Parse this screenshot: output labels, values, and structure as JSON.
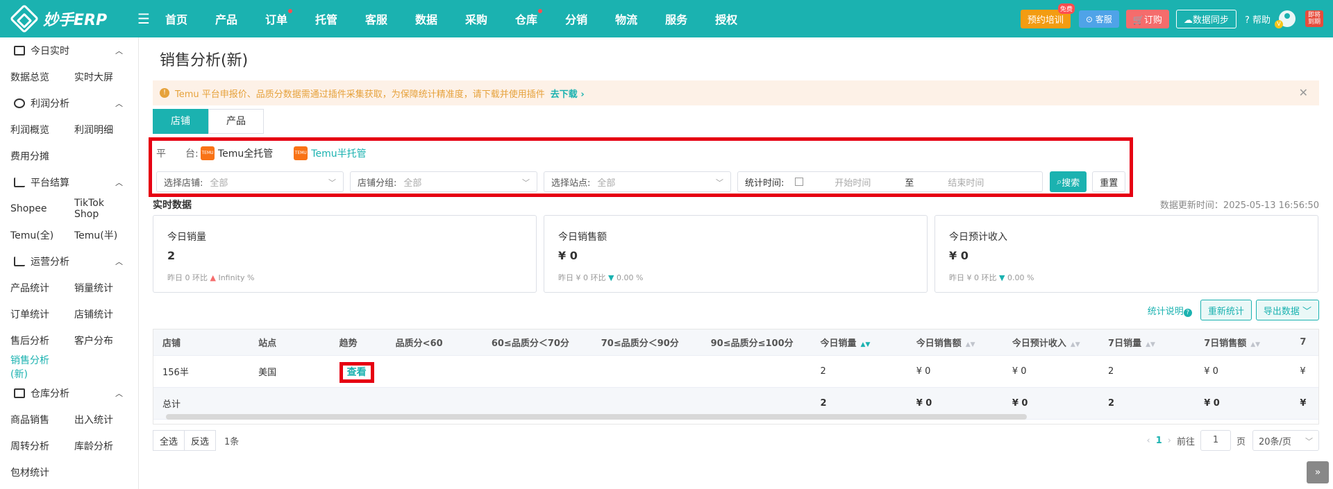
{
  "topbar": {
    "logo": "妙手ERP",
    "nav": [
      {
        "label": "首页",
        "dot": false
      },
      {
        "label": "产品",
        "dot": false
      },
      {
        "label": "订单",
        "dot": true
      },
      {
        "label": "托管",
        "dot": false
      },
      {
        "label": "客服",
        "dot": false
      },
      {
        "label": "数据",
        "dot": false
      },
      {
        "label": "采购",
        "dot": false
      },
      {
        "label": "仓库",
        "dot": true
      },
      {
        "label": "分销",
        "dot": false
      },
      {
        "label": "物流",
        "dot": false
      },
      {
        "label": "服务",
        "dot": false
      },
      {
        "label": "授权",
        "dot": false
      }
    ],
    "train": "预约培训",
    "free": "免费",
    "service": "客服",
    "order": "订购",
    "sync": "数据同步",
    "help": "帮助",
    "vip": "V",
    "promo": "即将到期"
  },
  "sidebar": {
    "sections": [
      {
        "title": "今日实时",
        "items": [
          "数据总览",
          "实时大屏"
        ]
      },
      {
        "title": "利润分析",
        "items": [
          "利润概览",
          "利润明细",
          "费用分摊"
        ]
      },
      {
        "title": "平台结算",
        "items": [
          "Shopee",
          "TikTok Shop",
          "Temu(全)",
          "Temu(半)"
        ]
      },
      {
        "title": "运营分析",
        "items": [
          "产品统计",
          "销量统计",
          "订单统计",
          "店铺统计",
          "售后分析",
          "客户分布",
          "销售分析(新)"
        ]
      },
      {
        "title": "仓库分析",
        "items": [
          "商品销售",
          "出入统计",
          "周转分析",
          "库龄分析",
          "包材统计"
        ]
      }
    ],
    "active": "销售分析(新)"
  },
  "page": {
    "title": "销售分析(新)",
    "alert": "Temu 平台申报价、品质分数据需通过插件采集获取，为保障统计精准度，请下载并使用插件",
    "alert_link": "去下载",
    "tabs": [
      "店铺",
      "产品"
    ],
    "platform_label": "平　　台:",
    "platforms": [
      "Temu全托管",
      "Temu半托管"
    ],
    "filters": {
      "store": {
        "label": "选择店铺:",
        "value": "全部"
      },
      "group": {
        "label": "店铺分组:",
        "value": "全部"
      },
      "site": {
        "label": "选择站点:",
        "value": "全部"
      },
      "time_label": "统计时间:",
      "start_ph": "开始时间",
      "to": "至",
      "end_ph": "结束时间",
      "search": "搜索",
      "reset": "重置"
    },
    "realtime_label": "实时数据",
    "update_time": "数据更新时间：2025-05-13 16:56:50",
    "cards": [
      {
        "title": "今日销量",
        "value": "2",
        "sub_prefix": "昨日 0  环比",
        "trend": "up",
        "sub_value": "Infinity %"
      },
      {
        "title": "今日销售额",
        "value": "¥ 0",
        "sub_prefix": "昨日 ¥ 0  环比",
        "trend": "down",
        "sub_value": "0.00 %"
      },
      {
        "title": "今日预计收入",
        "value": "¥ 0",
        "sub_prefix": "昨日 ¥ 0  环比",
        "trend": "down",
        "sub_value": "0.00 %"
      }
    ],
    "explain": "统计说明",
    "recount": "重新统计",
    "export": "导出数据"
  },
  "table": {
    "headers": [
      "店铺",
      "站点",
      "趋势",
      "品质分<60",
      "60≤品质分＜70分",
      "70≤品质分＜90分",
      "90≤品质分≤100分",
      "今日销量",
      "今日销售额",
      "今日预计收入",
      "7日销量",
      "7日销售额",
      "7"
    ],
    "row": [
      "156半",
      "美国",
      "查看",
      "",
      "",
      "",
      "",
      "2",
      "¥ 0",
      "¥ 0",
      "2",
      "¥ 0",
      "¥"
    ],
    "total": [
      "总计",
      "",
      "",
      "",
      "",
      "",
      "",
      "2",
      "¥ 0",
      "¥ 0",
      "2",
      "¥ 0",
      "¥"
    ]
  },
  "footer": {
    "select_all": "全选",
    "invert": "反选",
    "count": "1条",
    "page": "1",
    "goto": "前往",
    "page_input": "1",
    "page_unit": "页",
    "page_size": "20条/页"
  }
}
